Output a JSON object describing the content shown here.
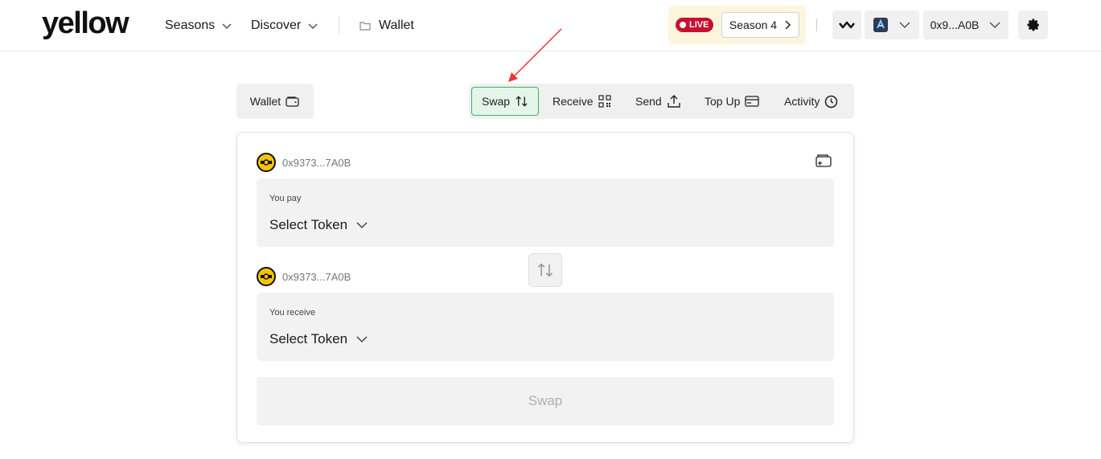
{
  "brand": {
    "logo_text": "yellow"
  },
  "nav": {
    "seasons_label": "Seasons",
    "discover_label": "Discover",
    "wallet_label": "Wallet"
  },
  "header": {
    "live_label": "LIVE",
    "season_label": "Season 4",
    "account_short": "0x9...A0B"
  },
  "tabs": {
    "wallet_label": "Wallet",
    "actions": [
      {
        "label": "Swap",
        "icon": "swap-vertical-icon",
        "active": true
      },
      {
        "label": "Receive",
        "icon": "qr-code-icon",
        "active": false
      },
      {
        "label": "Send",
        "icon": "upload-icon",
        "active": false
      },
      {
        "label": "Top Up",
        "icon": "card-icon",
        "active": false
      },
      {
        "label": "Activity",
        "icon": "clock-icon",
        "active": false
      }
    ]
  },
  "swap": {
    "from_account": "0x9373...7A0B",
    "to_account": "0x9373...7A0B",
    "pay_label": "You pay",
    "receive_label": "You receive",
    "pay_token": "Select Token",
    "receive_token": "Select Token",
    "submit_label": "Swap"
  },
  "colors": {
    "brand_yellow": "#f5c400",
    "live_red": "#c8102e",
    "active_green": "#3db16a",
    "annotation_red": "#e53935"
  }
}
